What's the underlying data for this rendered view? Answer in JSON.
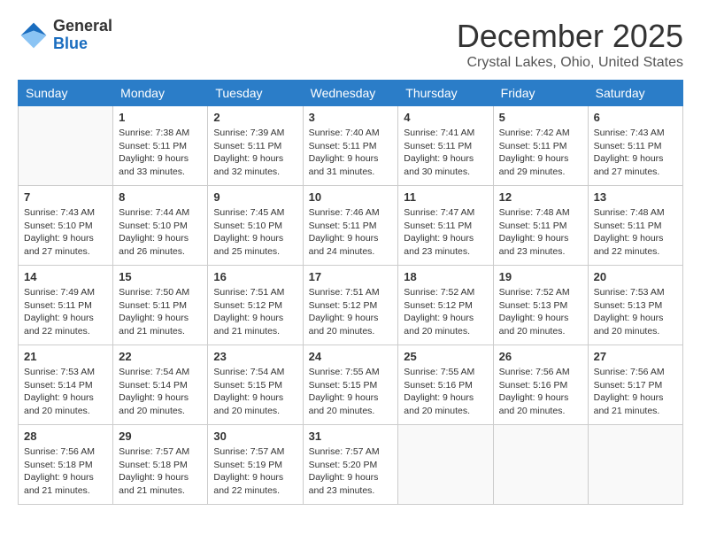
{
  "logo": {
    "general": "General",
    "blue": "Blue"
  },
  "title": "December 2025",
  "location": "Crystal Lakes, Ohio, United States",
  "weekdays": [
    "Sunday",
    "Monday",
    "Tuesday",
    "Wednesday",
    "Thursday",
    "Friday",
    "Saturday"
  ],
  "weeks": [
    [
      {
        "day": "",
        "info": ""
      },
      {
        "day": "1",
        "info": "Sunrise: 7:38 AM\nSunset: 5:11 PM\nDaylight: 9 hours\nand 33 minutes."
      },
      {
        "day": "2",
        "info": "Sunrise: 7:39 AM\nSunset: 5:11 PM\nDaylight: 9 hours\nand 32 minutes."
      },
      {
        "day": "3",
        "info": "Sunrise: 7:40 AM\nSunset: 5:11 PM\nDaylight: 9 hours\nand 31 minutes."
      },
      {
        "day": "4",
        "info": "Sunrise: 7:41 AM\nSunset: 5:11 PM\nDaylight: 9 hours\nand 30 minutes."
      },
      {
        "day": "5",
        "info": "Sunrise: 7:42 AM\nSunset: 5:11 PM\nDaylight: 9 hours\nand 29 minutes."
      },
      {
        "day": "6",
        "info": "Sunrise: 7:43 AM\nSunset: 5:11 PM\nDaylight: 9 hours\nand 27 minutes."
      }
    ],
    [
      {
        "day": "7",
        "info": "Sunrise: 7:43 AM\nSunset: 5:10 PM\nDaylight: 9 hours\nand 27 minutes."
      },
      {
        "day": "8",
        "info": "Sunrise: 7:44 AM\nSunset: 5:10 PM\nDaylight: 9 hours\nand 26 minutes."
      },
      {
        "day": "9",
        "info": "Sunrise: 7:45 AM\nSunset: 5:10 PM\nDaylight: 9 hours\nand 25 minutes."
      },
      {
        "day": "10",
        "info": "Sunrise: 7:46 AM\nSunset: 5:11 PM\nDaylight: 9 hours\nand 24 minutes."
      },
      {
        "day": "11",
        "info": "Sunrise: 7:47 AM\nSunset: 5:11 PM\nDaylight: 9 hours\nand 23 minutes."
      },
      {
        "day": "12",
        "info": "Sunrise: 7:48 AM\nSunset: 5:11 PM\nDaylight: 9 hours\nand 23 minutes."
      },
      {
        "day": "13",
        "info": "Sunrise: 7:48 AM\nSunset: 5:11 PM\nDaylight: 9 hours\nand 22 minutes."
      }
    ],
    [
      {
        "day": "14",
        "info": "Sunrise: 7:49 AM\nSunset: 5:11 PM\nDaylight: 9 hours\nand 22 minutes."
      },
      {
        "day": "15",
        "info": "Sunrise: 7:50 AM\nSunset: 5:11 PM\nDaylight: 9 hours\nand 21 minutes."
      },
      {
        "day": "16",
        "info": "Sunrise: 7:51 AM\nSunset: 5:12 PM\nDaylight: 9 hours\nand 21 minutes."
      },
      {
        "day": "17",
        "info": "Sunrise: 7:51 AM\nSunset: 5:12 PM\nDaylight: 9 hours\nand 20 minutes."
      },
      {
        "day": "18",
        "info": "Sunrise: 7:52 AM\nSunset: 5:12 PM\nDaylight: 9 hours\nand 20 minutes."
      },
      {
        "day": "19",
        "info": "Sunrise: 7:52 AM\nSunset: 5:13 PM\nDaylight: 9 hours\nand 20 minutes."
      },
      {
        "day": "20",
        "info": "Sunrise: 7:53 AM\nSunset: 5:13 PM\nDaylight: 9 hours\nand 20 minutes."
      }
    ],
    [
      {
        "day": "21",
        "info": "Sunrise: 7:53 AM\nSunset: 5:14 PM\nDaylight: 9 hours\nand 20 minutes."
      },
      {
        "day": "22",
        "info": "Sunrise: 7:54 AM\nSunset: 5:14 PM\nDaylight: 9 hours\nand 20 minutes."
      },
      {
        "day": "23",
        "info": "Sunrise: 7:54 AM\nSunset: 5:15 PM\nDaylight: 9 hours\nand 20 minutes."
      },
      {
        "day": "24",
        "info": "Sunrise: 7:55 AM\nSunset: 5:15 PM\nDaylight: 9 hours\nand 20 minutes."
      },
      {
        "day": "25",
        "info": "Sunrise: 7:55 AM\nSunset: 5:16 PM\nDaylight: 9 hours\nand 20 minutes."
      },
      {
        "day": "26",
        "info": "Sunrise: 7:56 AM\nSunset: 5:16 PM\nDaylight: 9 hours\nand 20 minutes."
      },
      {
        "day": "27",
        "info": "Sunrise: 7:56 AM\nSunset: 5:17 PM\nDaylight: 9 hours\nand 21 minutes."
      }
    ],
    [
      {
        "day": "28",
        "info": "Sunrise: 7:56 AM\nSunset: 5:18 PM\nDaylight: 9 hours\nand 21 minutes."
      },
      {
        "day": "29",
        "info": "Sunrise: 7:57 AM\nSunset: 5:18 PM\nDaylight: 9 hours\nand 21 minutes."
      },
      {
        "day": "30",
        "info": "Sunrise: 7:57 AM\nSunset: 5:19 PM\nDaylight: 9 hours\nand 22 minutes."
      },
      {
        "day": "31",
        "info": "Sunrise: 7:57 AM\nSunset: 5:20 PM\nDaylight: 9 hours\nand 23 minutes."
      },
      {
        "day": "",
        "info": ""
      },
      {
        "day": "",
        "info": ""
      },
      {
        "day": "",
        "info": ""
      }
    ]
  ]
}
